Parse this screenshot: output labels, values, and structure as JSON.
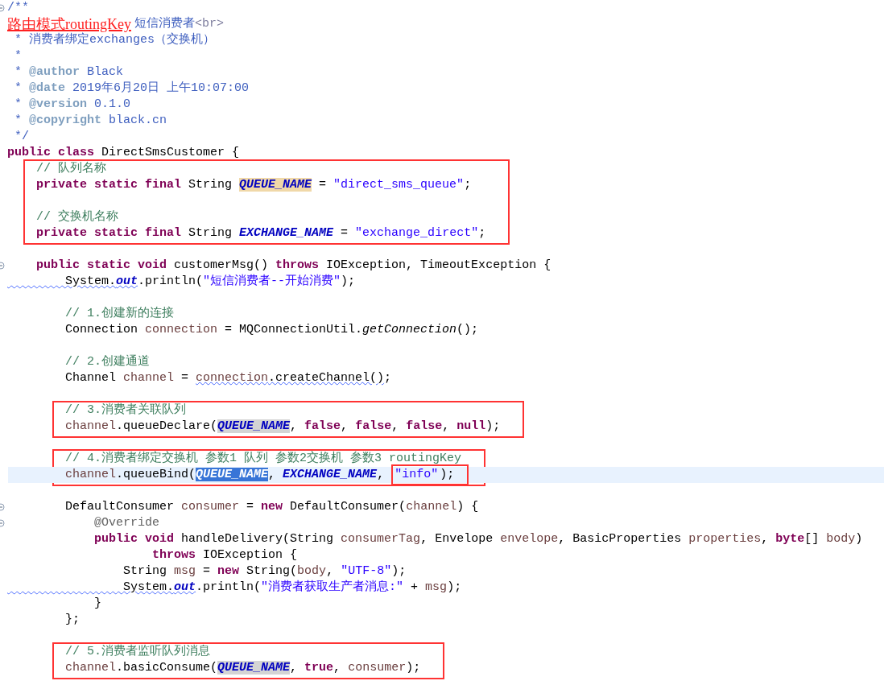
{
  "blocks": [
    {
      "boxed": false,
      "lines": [
        {
          "fold": true,
          "current": false,
          "tokens": [
            {
              "kind": "doc",
              "text": "/**"
            }
          ]
        },
        {
          "fold": false,
          "current": false,
          "tokens": [
            {
              "kind": "note",
              "text": "路由模式routingKey"
            },
            {
              "kind": "doc",
              "text": "短信消费者"
            },
            {
              "kind": "htmltag",
              "text": "<br>"
            }
          ]
        },
        {
          "fold": false,
          "current": false,
          "tokens": [
            {
              "kind": "doc",
              "text": " * 消费者绑定exchanges（交换机）"
            }
          ]
        },
        {
          "fold": false,
          "current": false,
          "tokens": [
            {
              "kind": "doc",
              "text": " *"
            }
          ]
        },
        {
          "fold": false,
          "current": false,
          "tokens": [
            {
              "kind": "doc",
              "text": " * "
            },
            {
              "kind": "tag",
              "text": "@author"
            },
            {
              "kind": "doc",
              "text": " Black"
            }
          ]
        },
        {
          "fold": false,
          "current": false,
          "tokens": [
            {
              "kind": "doc",
              "text": " * "
            },
            {
              "kind": "tag",
              "text": "@date"
            },
            {
              "kind": "doc",
              "text": " 2019年6月20日 上午10:07:00"
            }
          ]
        },
        {
          "fold": false,
          "current": false,
          "tokens": [
            {
              "kind": "doc",
              "text": " * "
            },
            {
              "kind": "tag",
              "text": "@version"
            },
            {
              "kind": "doc",
              "text": " 0.1.0"
            }
          ]
        },
        {
          "fold": false,
          "current": false,
          "tokens": [
            {
              "kind": "doc",
              "text": " * "
            },
            {
              "kind": "tag",
              "text": "@copyright"
            },
            {
              "kind": "doc",
              "text": " black.cn"
            }
          ]
        },
        {
          "fold": false,
          "current": false,
          "tokens": [
            {
              "kind": "doc",
              "text": " */"
            }
          ]
        },
        {
          "fold": false,
          "current": false,
          "tokens": [
            {
              "kind": "kw",
              "text": "public class "
            },
            {
              "kind": "plain",
              "text": "DirectSmsCustomer {"
            }
          ]
        }
      ]
    },
    {
      "boxed": true,
      "lines": [
        {
          "fold": false,
          "current": false,
          "tokens": [
            {
              "kind": "comment",
              "text": "    // 队列名称"
            }
          ]
        },
        {
          "fold": false,
          "current": false,
          "tokens": [
            {
              "kind": "kw",
              "text": "    private static final "
            },
            {
              "kind": "plain",
              "text": "String "
            },
            {
              "kind": "fieldocc",
              "text": "QUEUE_NAME"
            },
            {
              "kind": "plain",
              "text": " = "
            },
            {
              "kind": "str",
              "text": "\"direct_sms_queue\""
            },
            {
              "kind": "plain",
              "text": ";"
            }
          ]
        },
        {
          "fold": false,
          "current": false
        },
        {
          "fold": false,
          "current": false,
          "tokens": [
            {
              "kind": "comment",
              "text": "    // 交换机名称"
            }
          ]
        },
        {
          "fold": false,
          "current": false,
          "tokens": [
            {
              "kind": "kw",
              "text": "    private static final "
            },
            {
              "kind": "plain",
              "text": "String "
            },
            {
              "kind": "field",
              "text": "EXCHANGE_NAME"
            },
            {
              "kind": "plain",
              "text": " = "
            },
            {
              "kind": "str",
              "text": "\"exchange_direct\""
            },
            {
              "kind": "plain",
              "text": ";"
            }
          ]
        }
      ]
    },
    {
      "boxed": false,
      "lines": [
        {
          "fold": false,
          "current": false
        },
        {
          "fold": true,
          "current": false,
          "tokens": [
            {
              "kind": "kw",
              "text": "    public static void "
            },
            {
              "kind": "plain",
              "text": "customerMsg() "
            },
            {
              "kind": "kw",
              "text": "throws "
            },
            {
              "kind": "plain",
              "text": "IOException, TimeoutException {"
            }
          ]
        },
        {
          "fold": false,
          "current": false,
          "tokens": [
            {
              "kind": "warn",
              "text": "        System."
            },
            {
              "kind": "fieldwarn",
              "text": "out"
            },
            {
              "kind": "plain",
              "text": ".println("
            },
            {
              "kind": "str",
              "text": "\"短信消费者--开始消费\""
            },
            {
              "kind": "plain",
              "text": ");"
            }
          ]
        },
        {
          "fold": false,
          "current": false
        },
        {
          "fold": false,
          "current": false,
          "tokens": [
            {
              "kind": "comment",
              "text": "        // 1.创建新的连接"
            }
          ]
        },
        {
          "fold": false,
          "current": false,
          "tokens": [
            {
              "kind": "plain",
              "text": "        Connection "
            },
            {
              "kind": "local",
              "text": "connection"
            },
            {
              "kind": "plain",
              "text": " = MQConnectionUtil."
            },
            {
              "kind": "italic",
              "text": "getConnection"
            },
            {
              "kind": "plain",
              "text": "();"
            }
          ]
        },
        {
          "fold": false,
          "current": false
        },
        {
          "fold": false,
          "current": false,
          "tokens": [
            {
              "kind": "comment",
              "text": "        // 2.创建通道"
            }
          ]
        },
        {
          "fold": false,
          "current": false,
          "tokens": [
            {
              "kind": "plain",
              "text": "        Channel "
            },
            {
              "kind": "local",
              "text": "channel"
            },
            {
              "kind": "plain",
              "text": " = "
            },
            {
              "kind": "localwarn",
              "text": "connection"
            },
            {
              "kind": "warn",
              "text": ".createChannel()"
            },
            {
              "kind": "plain",
              "text": ";"
            }
          ]
        },
        {
          "fold": false,
          "current": false
        }
      ]
    },
    {
      "boxed": true,
      "lines": [
        {
          "fold": false,
          "current": false,
          "tokens": [
            {
              "kind": "comment",
              "text": "        // 3.消费者关联队列"
            }
          ]
        },
        {
          "fold": false,
          "current": false,
          "tokens": [
            {
              "kind": "local",
              "text": "        channel"
            },
            {
              "kind": "plain",
              "text": ".queueDeclare("
            },
            {
              "kind": "fieldhl",
              "text": "QUEUE_NAME"
            },
            {
              "kind": "plain",
              "text": ", "
            },
            {
              "kind": "kw",
              "text": "false"
            },
            {
              "kind": "plain",
              "text": ", "
            },
            {
              "kind": "kw",
              "text": "false"
            },
            {
              "kind": "plain",
              "text": ", "
            },
            {
              "kind": "kw",
              "text": "false"
            },
            {
              "kind": "plain",
              "text": ", "
            },
            {
              "kind": "kw",
              "text": "null"
            },
            {
              "kind": "plain",
              "text": ");"
            }
          ]
        }
      ]
    },
    {
      "boxed": false,
      "lines": [
        {
          "fold": false,
          "current": false
        }
      ]
    },
    {
      "boxed": true,
      "lines": [
        {
          "fold": false,
          "current": false,
          "tokens": [
            {
              "kind": "comment",
              "text": "        // 4.消费者绑定交换机 参数1 队列 参数2交换机 参数3 routingKey"
            }
          ]
        },
        {
          "fold": false,
          "current": true,
          "tokens": [
            {
              "kind": "local",
              "text": "        channel"
            },
            {
              "kind": "plain",
              "text": ".queueBind("
            },
            {
              "kind": "fieldsel",
              "text": "QUEUE_NAME"
            },
            {
              "kind": "plain",
              "text": ", "
            },
            {
              "kind": "field",
              "text": "EXCHANGE_NAME"
            },
            {
              "kind": "plain",
              "text": ", "
            },
            {
              "kind": "strbox",
              "text": "\"info\""
            },
            {
              "kind": "plain",
              "text": ");"
            }
          ]
        }
      ]
    },
    {
      "boxed": false,
      "lines": [
        {
          "fold": false,
          "current": false
        },
        {
          "fold": true,
          "current": false,
          "tokens": [
            {
              "kind": "plain",
              "text": "        DefaultConsumer "
            },
            {
              "kind": "local",
              "text": "consumer"
            },
            {
              "kind": "plain",
              "text": " = "
            },
            {
              "kind": "kw",
              "text": "new "
            },
            {
              "kind": "plain",
              "text": "DefaultConsumer("
            },
            {
              "kind": "local",
              "text": "channel"
            },
            {
              "kind": "plain",
              "text": ") {"
            }
          ]
        },
        {
          "fold": true,
          "current": false,
          "tokens": [
            {
              "kind": "anno",
              "text": "            @Override"
            }
          ]
        },
        {
          "fold": false,
          "current": false,
          "tokens": [
            {
              "kind": "kw",
              "text": "            public void "
            },
            {
              "kind": "plain",
              "text": "handleDelivery(String "
            },
            {
              "kind": "local",
              "text": "consumerTag"
            },
            {
              "kind": "plain",
              "text": ", Envelope "
            },
            {
              "kind": "local",
              "text": "envelope"
            },
            {
              "kind": "plain",
              "text": ", BasicProperties "
            },
            {
              "kind": "local",
              "text": "properties"
            },
            {
              "kind": "plain",
              "text": ", "
            },
            {
              "kind": "kw",
              "text": "byte"
            },
            {
              "kind": "plain",
              "text": "[] "
            },
            {
              "kind": "local",
              "text": "body"
            },
            {
              "kind": "plain",
              "text": ")"
            }
          ]
        },
        {
          "fold": false,
          "current": false,
          "tokens": [
            {
              "kind": "kw",
              "text": "                    throws "
            },
            {
              "kind": "plain",
              "text": "IOException {"
            }
          ]
        },
        {
          "fold": false,
          "current": false,
          "tokens": [
            {
              "kind": "plain",
              "text": "                String "
            },
            {
              "kind": "local",
              "text": "msg"
            },
            {
              "kind": "plain",
              "text": " = "
            },
            {
              "kind": "kw",
              "text": "new "
            },
            {
              "kind": "plain",
              "text": "String("
            },
            {
              "kind": "local",
              "text": "body"
            },
            {
              "kind": "plain",
              "text": ", "
            },
            {
              "kind": "str",
              "text": "\"UTF-8\""
            },
            {
              "kind": "plain",
              "text": ");"
            }
          ]
        },
        {
          "fold": false,
          "current": false,
          "tokens": [
            {
              "kind": "warn",
              "text": "                System."
            },
            {
              "kind": "fieldwarn",
              "text": "out"
            },
            {
              "kind": "plain",
              "text": ".println("
            },
            {
              "kind": "str",
              "text": "\"消费者获取生产者消息:\""
            },
            {
              "kind": "plain",
              "text": " + "
            },
            {
              "kind": "local",
              "text": "msg"
            },
            {
              "kind": "plain",
              "text": ");"
            }
          ]
        },
        {
          "fold": false,
          "current": false,
          "tokens": [
            {
              "kind": "plain",
              "text": "            }"
            }
          ]
        },
        {
          "fold": false,
          "current": false,
          "tokens": [
            {
              "kind": "plain",
              "text": "        };"
            }
          ]
        },
        {
          "fold": false,
          "current": false
        }
      ]
    },
    {
      "boxed": true,
      "lines": [
        {
          "fold": false,
          "current": false,
          "tokens": [
            {
              "kind": "comment",
              "text": "        // 5.消费者监听队列消息"
            }
          ]
        },
        {
          "fold": false,
          "current": false,
          "tokens": [
            {
              "kind": "local",
              "text": "        channel"
            },
            {
              "kind": "plain",
              "text": ".basicConsume("
            },
            {
              "kind": "fieldhl",
              "text": "QUEUE_NAME"
            },
            {
              "kind": "plain",
              "text": ", "
            },
            {
              "kind": "kw",
              "text": "true"
            },
            {
              "kind": "plain",
              "text": ", "
            },
            {
              "kind": "local",
              "text": "consumer"
            },
            {
              "kind": "plain",
              "text": ");"
            }
          ]
        }
      ]
    }
  ]
}
